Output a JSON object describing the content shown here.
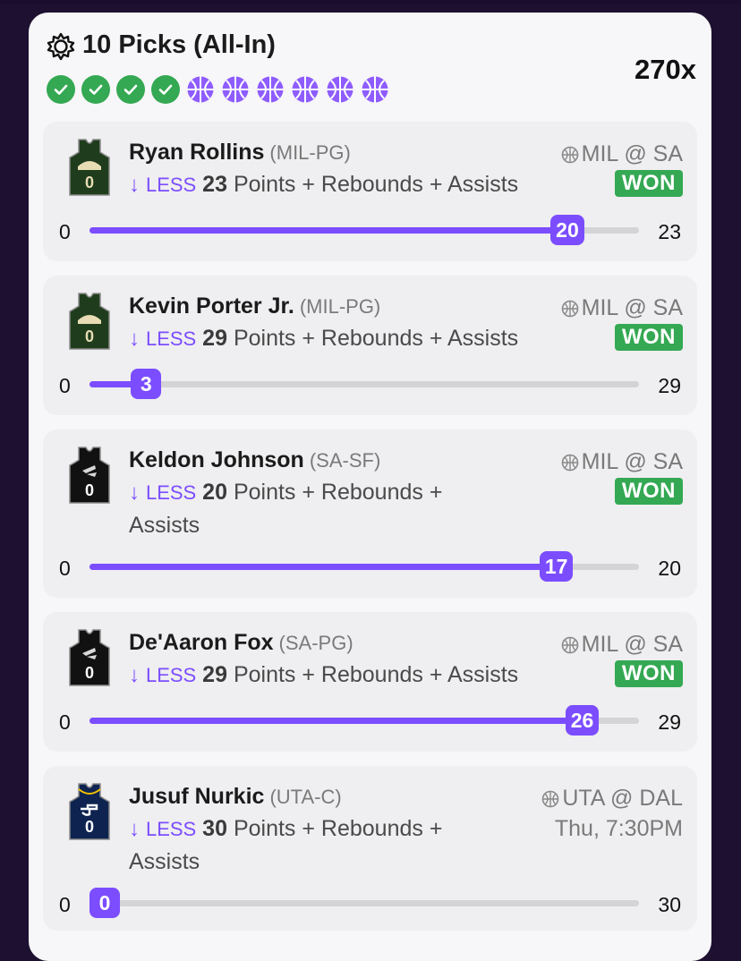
{
  "header": {
    "title": "10 Picks (All-In)",
    "multiplier": "270x",
    "icon": "sun-gear-icon",
    "picks_status": [
      "won",
      "won",
      "won",
      "won",
      "pending",
      "pending",
      "pending",
      "pending",
      "pending",
      "pending"
    ]
  },
  "colors": {
    "accent": "#7b4dff",
    "won": "#34a853",
    "card_bg": "#efeef0"
  },
  "picks": [
    {
      "player": "Ryan Rollins",
      "position": "(MIL-PG)",
      "direction": "LESS",
      "line_value": "23",
      "stat": "Points + Rebounds + Assists",
      "game": "MIL @ SA",
      "status": "WON",
      "time": "",
      "bar_min": "0",
      "bar_max": "23",
      "current": "20",
      "progress": 0.87,
      "jersey": {
        "color": "#1f3d1c",
        "number": "0",
        "team": "MIL"
      }
    },
    {
      "player": "Kevin Porter Jr.",
      "position": "(MIL-PG)",
      "direction": "LESS",
      "line_value": "29",
      "stat": "Points + Rebounds + Assists",
      "game": "MIL @ SA",
      "status": "WON",
      "time": "",
      "bar_min": "0",
      "bar_max": "29",
      "current": "3",
      "progress": 0.103,
      "jersey": {
        "color": "#1f3d1c",
        "number": "0",
        "team": "MIL"
      }
    },
    {
      "player": "Keldon Johnson",
      "position": "(SA-SF)",
      "direction": "LESS",
      "line_value": "20",
      "stat": "Points + Rebounds + Assists",
      "game": "MIL @ SA",
      "status": "WON",
      "time": "",
      "bar_min": "0",
      "bar_max": "20",
      "current": "17",
      "progress": 0.85,
      "jersey": {
        "color": "#111111",
        "number": "0",
        "team": "SA"
      }
    },
    {
      "player": "De'Aaron Fox",
      "position": "(SA-PG)",
      "direction": "LESS",
      "line_value": "29",
      "stat": "Points + Rebounds + Assists",
      "game": "MIL @ SA",
      "status": "WON",
      "time": "",
      "bar_min": "0",
      "bar_max": "29",
      "current": "26",
      "progress": 0.897,
      "jersey": {
        "color": "#111111",
        "number": "0",
        "team": "SA"
      }
    },
    {
      "player": "Jusuf Nurkic",
      "position": "(UTA-C)",
      "direction": "LESS",
      "line_value": "30",
      "stat": "Points + Rebounds + Assists",
      "game": "UTA @ DAL",
      "status": "",
      "time": "Thu, 7:30PM",
      "bar_min": "0",
      "bar_max": "30",
      "current": "0",
      "progress": 0,
      "jersey": {
        "color": "#0e2350",
        "number": "0",
        "team": "UTA"
      }
    }
  ]
}
